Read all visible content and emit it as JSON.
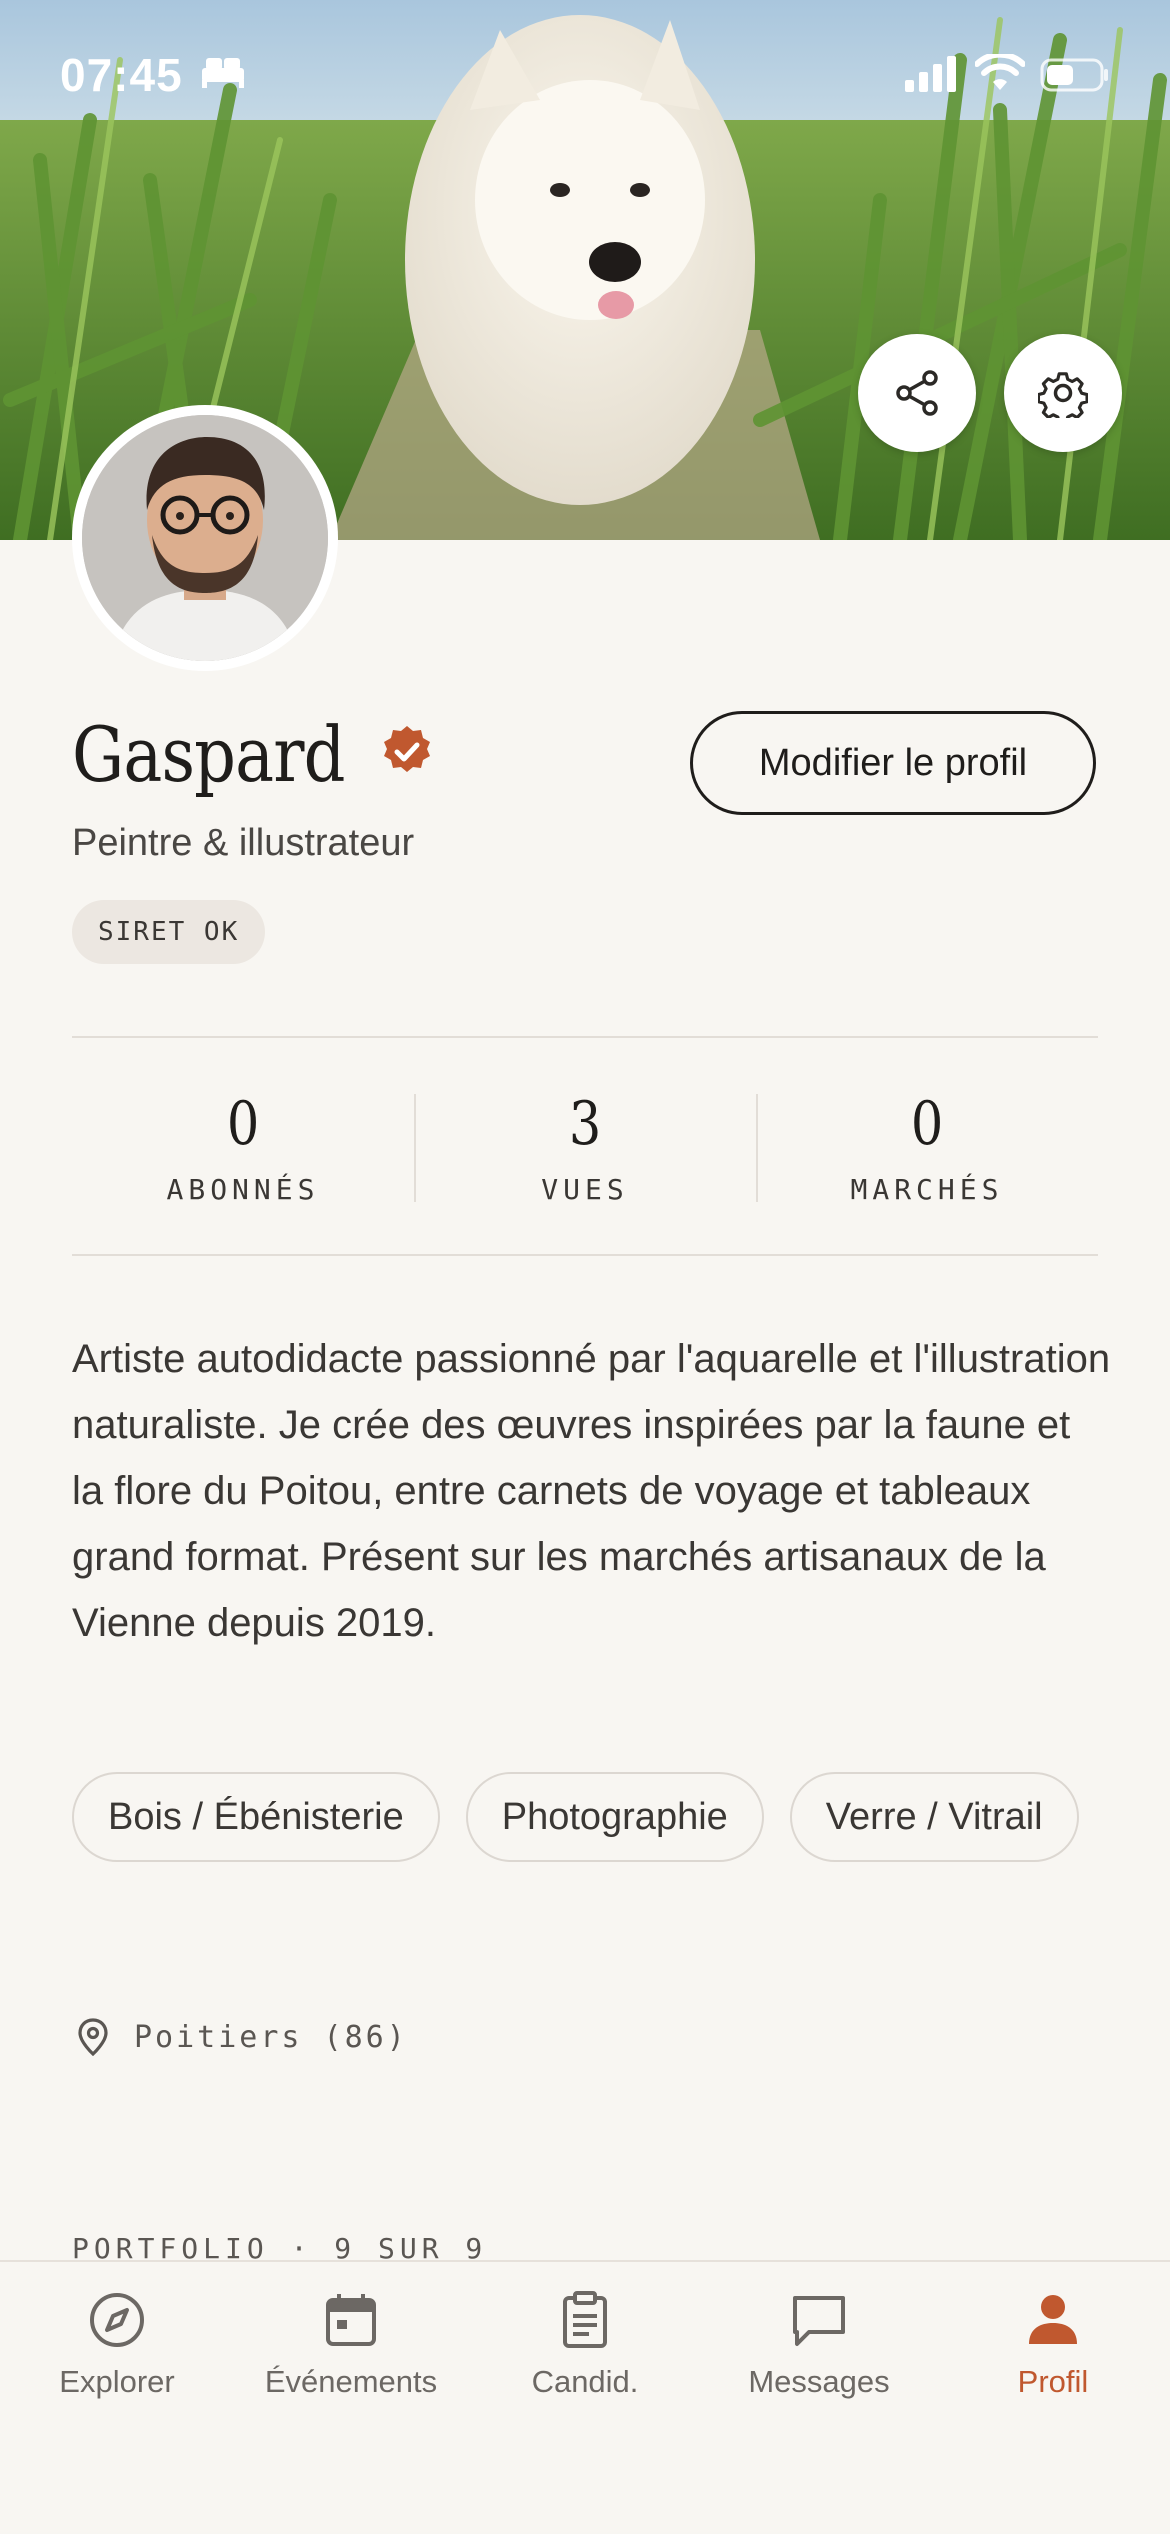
{
  "status_bar": {
    "time": "07:45"
  },
  "profile": {
    "name": "Gaspard",
    "subtitle": "Peintre & illustrateur",
    "badge": "SIRET OK",
    "edit_label": "Modifier le profil",
    "verified_icon": "verified-badge-icon",
    "accent_color": "#c0582f"
  },
  "stats": [
    {
      "value": "0",
      "label": "ABONNÉS"
    },
    {
      "value": "3",
      "label": "VUES"
    },
    {
      "value": "0",
      "label": "MARCHÉS"
    }
  ],
  "bio": "Artiste autodidacte passionné par l'aquarelle et l'illustration naturaliste. Je crée des œuvres inspirées par la faune et la flore du Poitou, entre carnets de voyage et tableaux grand format. Présent sur les marchés artisanaux de la Vienne depuis 2019.",
  "tags": [
    "Bois / Ébénisterie",
    "Photographie",
    "Verre / Vitrail"
  ],
  "location": "Poitiers (86)",
  "portfolio_label": "PORTFOLIO · 9 SUR 9",
  "tabs": [
    {
      "label": "Explorer",
      "icon": "compass-icon",
      "active": false
    },
    {
      "label": "Événements",
      "icon": "calendar-icon",
      "active": false
    },
    {
      "label": "Candid.",
      "icon": "clipboard-icon",
      "active": false
    },
    {
      "label": "Messages",
      "icon": "message-icon",
      "active": false
    },
    {
      "label": "Profil",
      "icon": "person-icon",
      "active": true
    }
  ]
}
